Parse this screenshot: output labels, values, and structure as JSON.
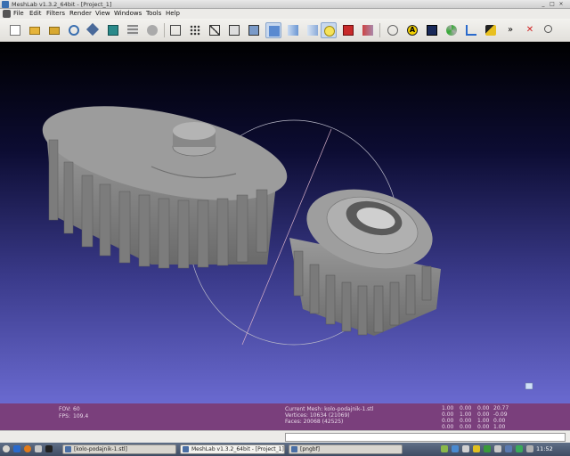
{
  "window": {
    "title": "MeshLab v1.3.2_64bit - [Project_1]",
    "controls": {
      "minimize": "_",
      "maximize": "□",
      "close": "×"
    }
  },
  "menu": [
    "File",
    "Edit",
    "Filters",
    "Render",
    "View",
    "Windows",
    "Tools",
    "Help"
  ],
  "toolbar": {
    "icons": [
      "new-document-icon",
      "open-folder-icon",
      "open-project-icon",
      "reload-icon",
      "save-icon",
      "snapshot-icon",
      "layers-icon",
      "align-icon",
      "bounding-box-icon",
      "points-icon",
      "wireframe-icon",
      "hidden-lines-icon",
      "flat-lines-icon",
      "flat-icon",
      "smooth-icon",
      "texture-icon",
      "light-icon",
      "light-color-icon",
      "vertex-color-icon",
      "globe-icon",
      "annotation-icon",
      "shader-icon",
      "color-mesh-icon",
      "axes-icon",
      "paint-icon",
      "more-icon",
      "delete-icon",
      "zoom-icon"
    ],
    "more_label": "»",
    "annotation_label": "A"
  },
  "info": {
    "fov_label": "FOV:",
    "fov_value": "60",
    "fps_label": "FPS:",
    "fps_value": "109.4",
    "current_mesh": "Current Mesh: kolo-podajnik-1.stl",
    "vertices": "Vertices: 10634 (21069)",
    "faces": "Faces: 20068 (42525)",
    "matrix": [
      [
        "1.00",
        "0.00",
        "0.00",
        "20.77"
      ],
      [
        "0.00",
        "1.00",
        "0.00",
        "-0.09"
      ],
      [
        "0.00",
        "0.00",
        "1.00",
        "0.00"
      ],
      [
        "0.00",
        "0.00",
        "0.00",
        "1.00"
      ]
    ]
  },
  "taskbar": {
    "tasks": [
      {
        "label": "[kolo-podajnik-1.stl]"
      },
      {
        "label": "MeshLab v1.3.2_64bit - [Project_1]"
      },
      {
        "label": "[pngbf]"
      }
    ],
    "clock": "11:52"
  },
  "colors": {
    "viewport_top": "#000000",
    "viewport_bottom": "#6a6ad0",
    "info_panel": "#7a3f7c",
    "gear": "#8a8a8a"
  }
}
